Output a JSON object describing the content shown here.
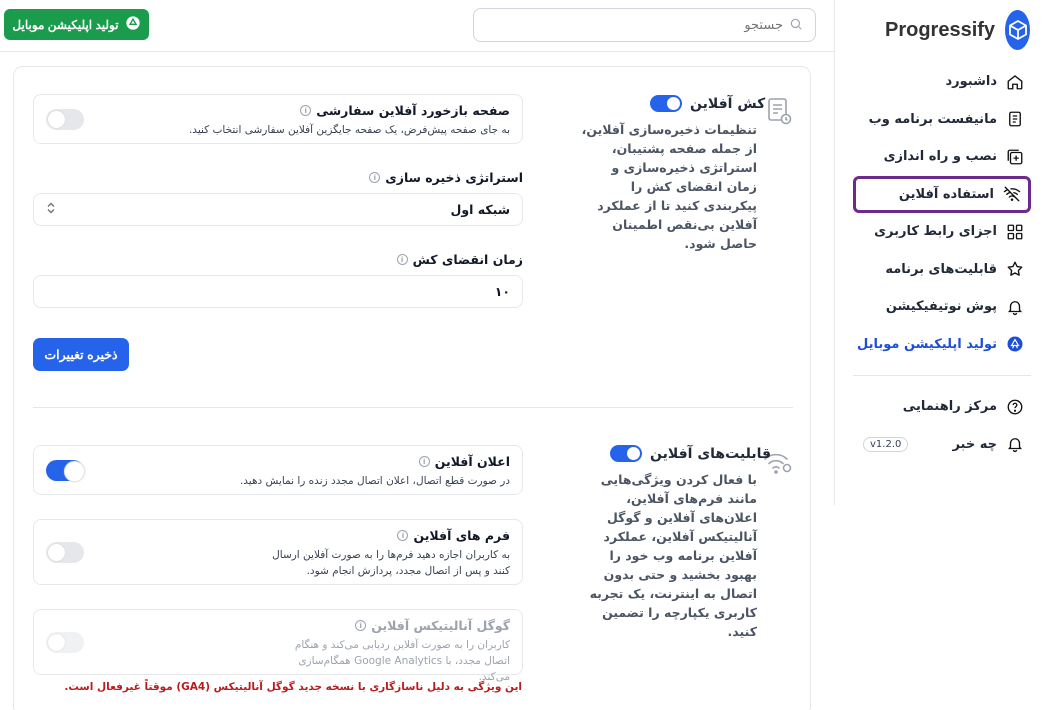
{
  "app": {
    "name": "Progressify",
    "cta_label": "تولید اپلیکیشن موبایل",
    "search_placeholder": "جستجو"
  },
  "sidebar": {
    "items": [
      {
        "label": "داشبورد",
        "icon": "home-icon"
      },
      {
        "label": "مانیفست برنامه وب",
        "icon": "document-icon"
      },
      {
        "label": "نصب و راه اندازی",
        "icon": "install-icon"
      },
      {
        "label": "استفاده آفلاین",
        "icon": "wifi-off-icon",
        "active": true
      },
      {
        "label": "اجزای رابط کاربری",
        "icon": "grid-icon"
      },
      {
        "label": "قابلیت‌های برنامه",
        "icon": "star-icon"
      },
      {
        "label": "پوش نوتیفیکیشن",
        "icon": "bell-icon"
      },
      {
        "label": "تولید اپلیکیشن موبایل",
        "icon": "app-store-icon"
      }
    ],
    "bottom": [
      {
        "label": "مرکز راهنمایی",
        "icon": "help-icon"
      },
      {
        "label": "چه خبر",
        "icon": "bell-icon",
        "badge": "v1.2.0"
      }
    ]
  },
  "cache": {
    "title": "کش آفلاین",
    "enabled": true,
    "description": "تنظیمات ذخیره‌سازی آفلاین، از جمله صفحه پشتیبان، استراتژی ذخیره‌سازی و زمان انقضای کش را پیکربندی کنید تا از عملکرد آفلاین بی‌نقص اطمینان حاصل شود.",
    "fallback": {
      "title": "صفحه بازخورد آفلاین سفارشی",
      "description": "به جای صفحه پیش‌فرض، یک صفحه جایگزین آفلاین سفارشی انتخاب کنید.",
      "enabled": false
    },
    "strategy": {
      "label": "استراتژی ذخیره سازی",
      "value": "شبکه اول"
    },
    "expiry": {
      "label": "زمان انقضای کش",
      "value": "۱۰"
    },
    "save_label": "ذخیره تغییرات"
  },
  "features": {
    "title": "قابلیت‌های آفلاین",
    "enabled": true,
    "description": "با فعال کردن ویژگی‌هایی مانند فرم‌های آفلاین، اعلان‌های آفلاین و گوگل آنالیتیکس آفلاین، عملکرد آفلاین برنامه وب خود را بهبود بخشید و حتی بدون اتصال به اینترنت، یک تجربه کاربری یکپارچه را تضمین کنید.",
    "cards": [
      {
        "title": "اعلان آفلاین",
        "description": "در صورت قطع اتصال، اعلان اتصال مجدد زنده را نمایش دهید.",
        "enabled": true,
        "disabled": false
      },
      {
        "title": "فرم های آفلاین",
        "description": "به کاربران اجازه دهید فرم‌ها را به صورت آفلاین ارسال کنند و پس از اتصال مجدد، پردازش انجام شود.",
        "enabled": false,
        "disabled": false
      },
      {
        "title": "گوگل آنالیتیکس آفلاین",
        "description": "کاربران را به صورت آفلاین ردیابی می‌کند و هنگام اتصال مجدد، با Google Analytics همگام‌سازی می‌کند.",
        "enabled": false,
        "disabled": true
      }
    ],
    "warning": "این ویژگی به دلیل ناسازگاری با نسخه جدید گوگل آنالیتیکس (GA4) موقتاً غیرفعال است."
  },
  "colors": {
    "accent": "#2563eb",
    "cta": "#1a9c4c",
    "active_border": "#6b2a8c",
    "warning": "#b91c1c"
  }
}
